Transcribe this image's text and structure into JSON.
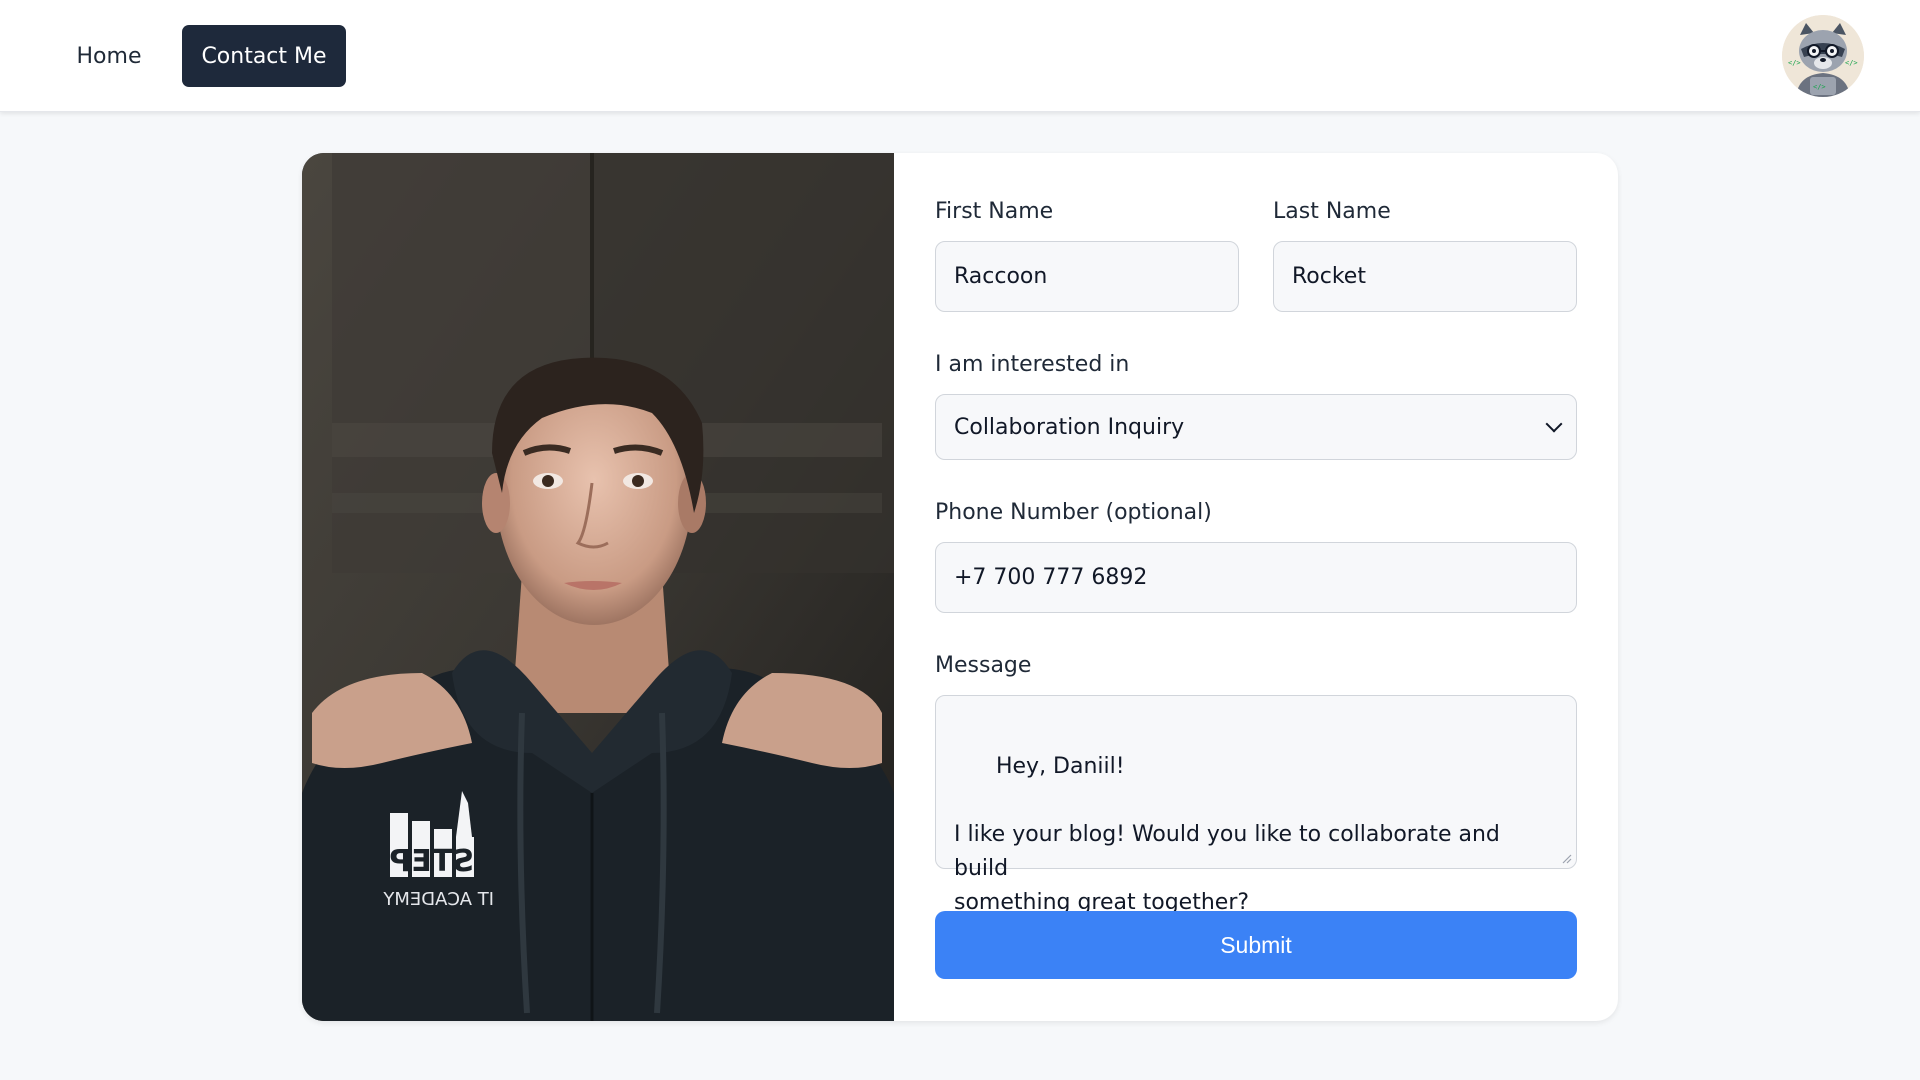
{
  "nav": {
    "home_label": "Home",
    "contact_label": "Contact Me",
    "active": "Contact Me"
  },
  "form": {
    "first_name": {
      "label": "First Name",
      "value": "Raccoon"
    },
    "last_name": {
      "label": "Last Name",
      "value": "Rocket"
    },
    "interest": {
      "label": "I am interested in",
      "selected": "Collaboration Inquiry"
    },
    "phone": {
      "label": "Phone Number (optional)",
      "value": "+7 700 777 6892"
    },
    "message": {
      "label": "Message",
      "value": "Hey, Daniil!\n\nI like your blog! Would you like to collaborate and build\nsomething great together?"
    },
    "submit_label": "Submit"
  },
  "photo": {
    "hoodie_print_top": "STEP",
    "hoodie_print_bottom": "IT ACADEMY"
  },
  "colors": {
    "primary": "#3b82f6",
    "nav_active_bg": "#1e293b",
    "page_bg": "#f6f8fa"
  },
  "icons": {
    "avatar": "raccoon-developer-avatar",
    "select_chevron": "chevron-down-icon"
  }
}
